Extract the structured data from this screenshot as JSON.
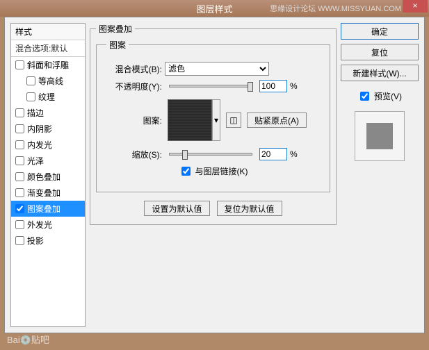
{
  "titlebar": {
    "title": "图层样式",
    "watermark": "思缘设计论坛  WWW.MISSYUAN.COM",
    "close": "×"
  },
  "styles": {
    "header": "样式",
    "sub": "混合选项:默认",
    "items": [
      {
        "label": "斜面和浮雕",
        "checked": false,
        "indent": false
      },
      {
        "label": "等高线",
        "checked": false,
        "indent": true
      },
      {
        "label": "纹理",
        "checked": false,
        "indent": true
      },
      {
        "label": "描边",
        "checked": false,
        "indent": false
      },
      {
        "label": "内阴影",
        "checked": false,
        "indent": false
      },
      {
        "label": "内发光",
        "checked": false,
        "indent": false
      },
      {
        "label": "光泽",
        "checked": false,
        "indent": false
      },
      {
        "label": "颜色叠加",
        "checked": false,
        "indent": false
      },
      {
        "label": "渐变叠加",
        "checked": false,
        "indent": false
      },
      {
        "label": "图案叠加",
        "checked": true,
        "indent": false,
        "selected": true
      },
      {
        "label": "外发光",
        "checked": false,
        "indent": false
      },
      {
        "label": "投影",
        "checked": false,
        "indent": false
      }
    ]
  },
  "main": {
    "group_title": "图案叠加",
    "inner_title": "图案",
    "blend_label": "混合模式(B):",
    "blend_value": "滤色",
    "opacity_label": "不透明度(Y):",
    "opacity_value": "100",
    "percent": "%",
    "pattern_label": "图案:",
    "snap_btn": "贴紧原点(A)",
    "scale_label": "缩放(S):",
    "scale_value": "20",
    "link_label": "与图层链接(K)",
    "link_checked": true,
    "set_default": "设置为默认值",
    "reset_default": "复位为默认值"
  },
  "right": {
    "ok": "确定",
    "cancel": "复位",
    "new_style": "新建样式(W)...",
    "preview_label": "预览(V)",
    "preview_checked": true
  },
  "footer": "Bai💿贴吧"
}
